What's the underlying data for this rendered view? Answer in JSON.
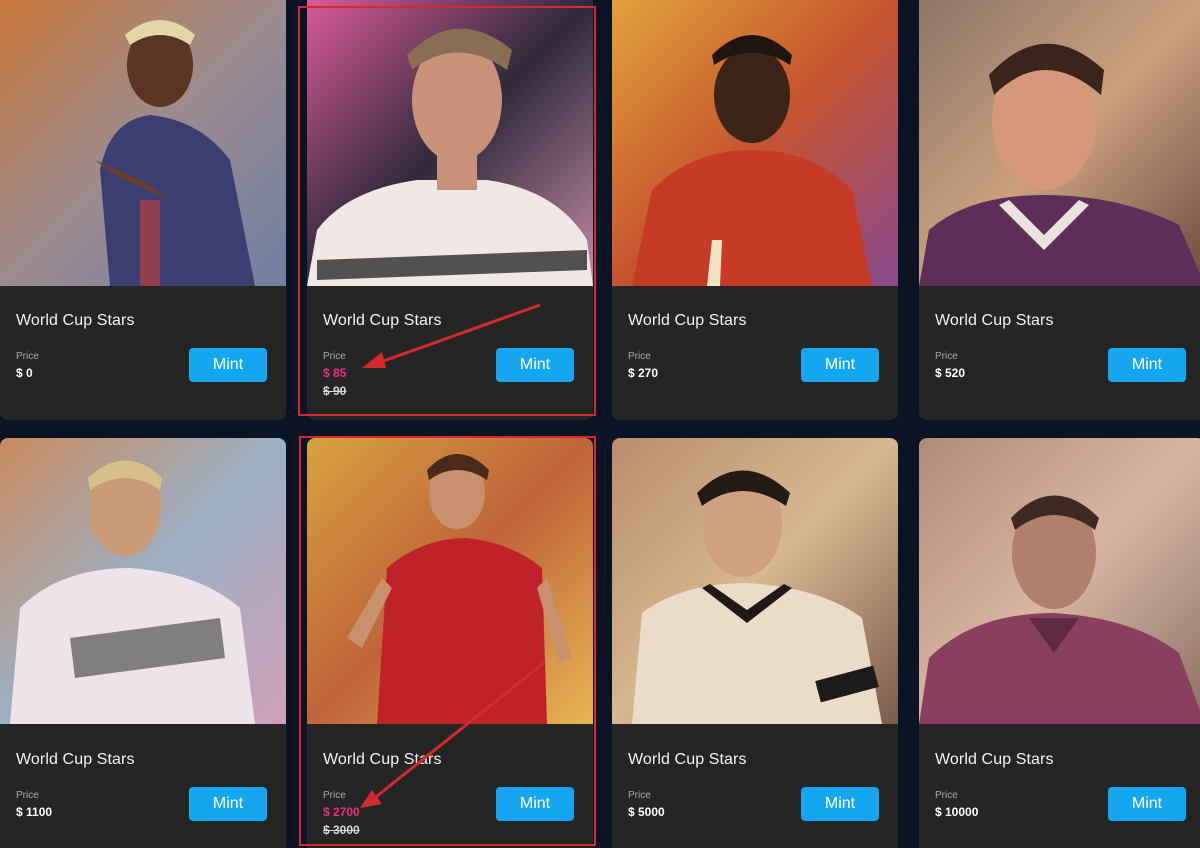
{
  "cards": [
    {
      "title": "World Cup Stars",
      "price_label": "Price",
      "price": "$ 0",
      "old_price": "",
      "button": "Mint",
      "sale": false
    },
    {
      "title": "World Cup Stars",
      "price_label": "Price",
      "price": "$ 85",
      "old_price": "$ 90",
      "button": "Mint",
      "sale": true
    },
    {
      "title": "World Cup Stars",
      "price_label": "Price",
      "price": "$ 270",
      "old_price": "",
      "button": "Mint",
      "sale": false
    },
    {
      "title": "World Cup Stars",
      "price_label": "Price",
      "price": "$ 520",
      "old_price": "",
      "button": "Mint",
      "sale": false
    },
    {
      "title": "World Cup Stars",
      "price_label": "Price",
      "price": "$ 1100",
      "old_price": "",
      "button": "Mint",
      "sale": false
    },
    {
      "title": "World Cup Stars",
      "price_label": "Price",
      "price": "$ 2700",
      "old_price": "$ 3000",
      "button": "Mint",
      "sale": true
    },
    {
      "title": "World Cup Stars",
      "price_label": "Price",
      "price": "$ 5000",
      "old_price": "",
      "button": "Mint",
      "sale": false
    },
    {
      "title": "World Cup Stars",
      "price_label": "Price",
      "price": "$ 10000",
      "old_price": "",
      "button": "Mint",
      "sale": false
    }
  ],
  "colors": {
    "page_background": "#0b1424",
    "card_background": "#252525",
    "button": "#14a7ef",
    "sale_price": "#e8327d",
    "annotation": "#d42a2f"
  }
}
